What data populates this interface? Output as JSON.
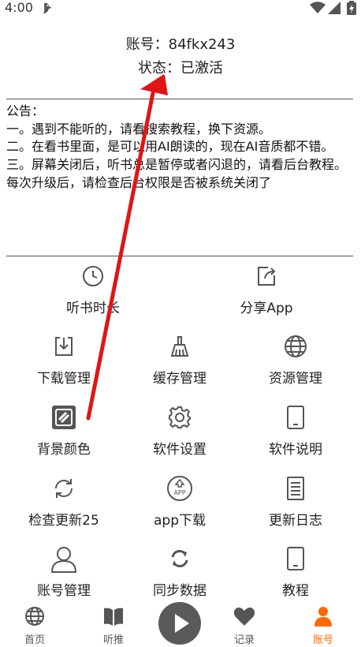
{
  "status_bar": {
    "time": "4:00"
  },
  "account": {
    "line": "账号：84fkx243",
    "status": "状态：已激活"
  },
  "notice": {
    "title": "公告：",
    "lines": [
      "一。遇到不能听的，请看搜索教程，换下资源。",
      "二。在看书里面，是可以用AI朗读的，现在AI音质都不错。",
      "三。屏幕关闭后，听书总是暂停或者闪退的，请看后台教程。每次升级后，请检查后台权限是否被系统关闭了"
    ]
  },
  "menu": {
    "listen_duration": "听书时长",
    "share_app": "分享App",
    "download_manage": "下载管理",
    "cache_manage": "缓存管理",
    "source_manage": "资源管理",
    "bg_color": "背景颜色",
    "software_settings": "软件设置",
    "software_info": "软件说明",
    "check_update": "检查更新25",
    "app_download": "app下载",
    "changelog": "更新日志",
    "account_manage": "账号管理",
    "sync_data": "同步数据",
    "tutorial": "教程",
    "app_badge": "APP"
  },
  "nav": {
    "home": "首页",
    "listen_recommend": "听推",
    "records": "记录",
    "account": "账号"
  },
  "colors": {
    "active": "#ff6a00",
    "arrow": "#e01515",
    "icon": "#555555"
  }
}
